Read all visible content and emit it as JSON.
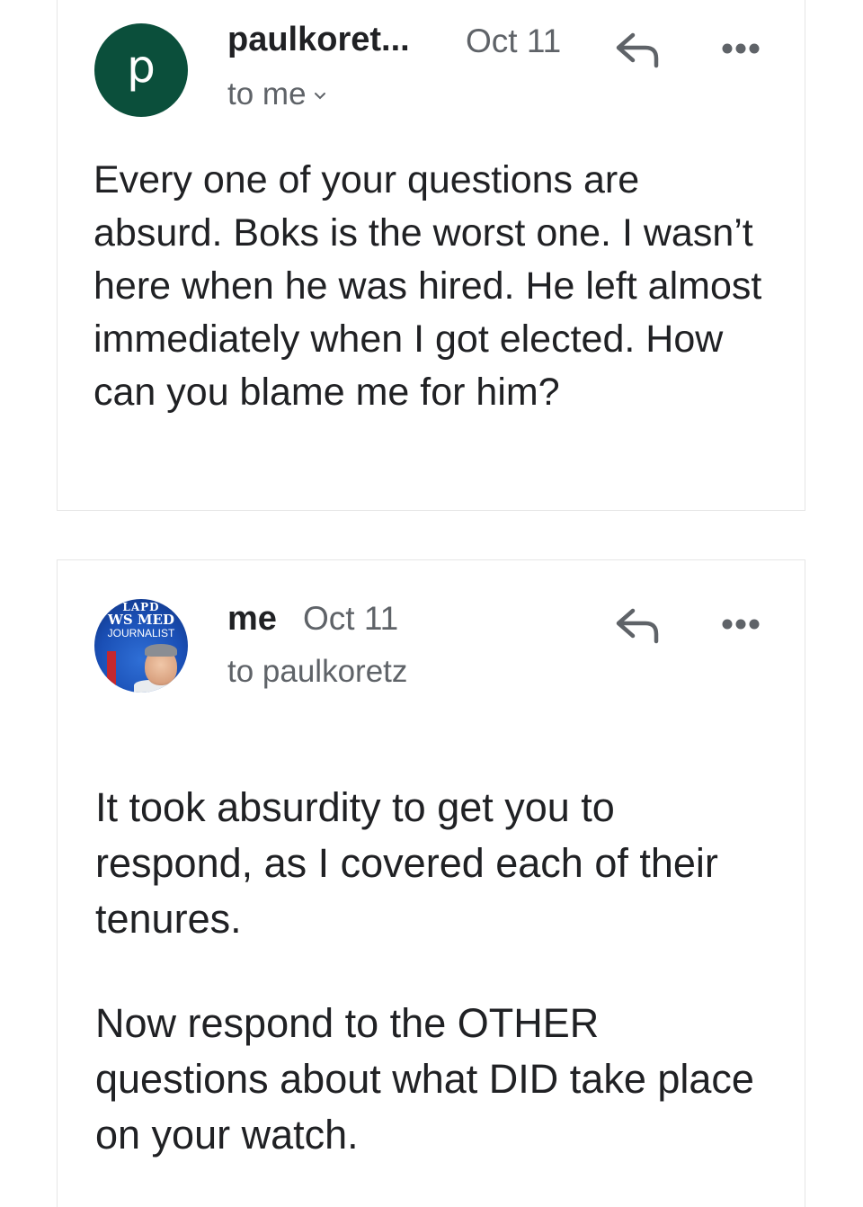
{
  "messages": [
    {
      "avatar_letter": "p",
      "sender": "paulkoret...",
      "date": "Oct 11",
      "recipient": "to me",
      "body": [
        "Every one of your questions are absurd. Boks is the worst one. I wasn’t here when he was hired. He left almost immediately when I got elected. How can you blame me for him?"
      ]
    },
    {
      "avatar_text": [
        "LAPD",
        "WS MED",
        "JOURNALIST"
      ],
      "sender": "me",
      "date": "Oct 11",
      "recipient": "to paulkoretz",
      "body": [
        "It took absurdity to get you to respond, as I covered each of their tenures.",
        "Now respond to the OTHER questions about what DID take place on your watch."
      ]
    }
  ],
  "icons": {
    "reply": "reply-icon",
    "more": "more-horizontal-icon",
    "expand": "chevron-down-icon"
  },
  "colors": {
    "avatar_bg": "#0b4f3b",
    "secondary_text": "#5f6368",
    "primary_text": "#202124"
  }
}
